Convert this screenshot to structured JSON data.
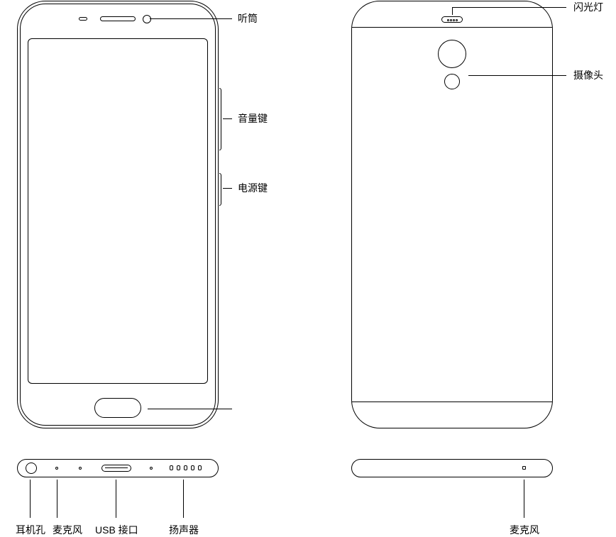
{
  "labels": {
    "earpiece": "听筒",
    "volume_key": "音量键",
    "power_key": "电源键",
    "flash": "闪光灯",
    "camera": "摄像头",
    "headphone_jack": "耳机孔",
    "mic_front": "麦克风",
    "usb_port": "USB 接口",
    "speaker": "扬声器",
    "mic_top": "麦克风"
  }
}
